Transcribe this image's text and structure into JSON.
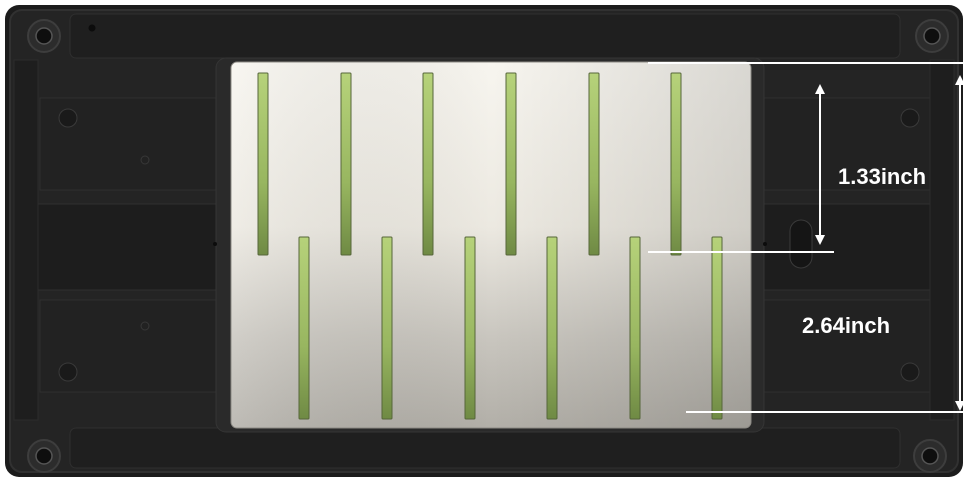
{
  "dimensions": {
    "upper_label": "1.33inch",
    "lower_label": "2.64inch"
  },
  "colors": {
    "housing": "#1f1f1f",
    "housing_edge": "#2e2e2e",
    "plate_light": "#f4f1ea",
    "plate_shadow": "#a9a69f",
    "slot_green": "#a8c86a",
    "dimension_lines": "#ffffff"
  },
  "icons": [
    "mounting-screw-icon"
  ]
}
